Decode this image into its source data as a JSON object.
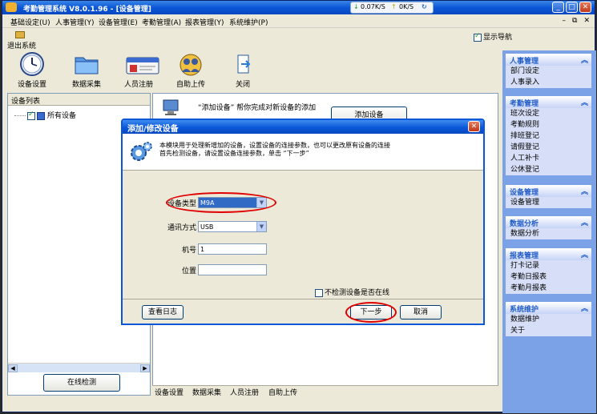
{
  "window": {
    "title": "考勤管理系统 V8.0.1.96 - [设备管理]",
    "speed": {
      "down": "0.07K/S",
      "up": "0K/S"
    }
  },
  "menu": {
    "items": [
      "基础设定(U)",
      "人事管理(Y)",
      "设备管理(E)",
      "考勤管理(A)",
      "报表管理(Y)",
      "系统维护(P)"
    ]
  },
  "toolbar": {
    "exit_label": "退出系统",
    "show_nav_label": "显示导航",
    "buttons": [
      "设备设置",
      "数据采集",
      "人员注册",
      "自助上传",
      "关闭"
    ]
  },
  "device_list": {
    "header": "设备列表",
    "root_item": "所有设备",
    "online_check_button": "在线检测"
  },
  "center": {
    "hint": "“添加设备” 帮你完成对新设备的添加",
    "add_button": "添加设备"
  },
  "bottom_tabs": [
    "设备设置",
    "数据采集",
    "人员注册",
    "自助上传"
  ],
  "nav": {
    "groups": [
      {
        "title": "人事管理",
        "items": [
          "部门设定",
          "人事录入"
        ]
      },
      {
        "title": "考勤管理",
        "items": [
          "班次设定",
          "考勤规则",
          "排班登记",
          "请假登记",
          "人工补卡",
          "公休登记"
        ]
      },
      {
        "title": "设备管理",
        "items": [
          "设备管理"
        ]
      },
      {
        "title": "数据分析",
        "items": [
          "数据分析"
        ]
      },
      {
        "title": "报表管理",
        "items": [
          "打卡记录",
          "考勤日报表",
          "考勤月报表"
        ]
      },
      {
        "title": "系统维护",
        "items": [
          "数据维护",
          "关于"
        ]
      }
    ]
  },
  "dialog": {
    "title": "添加/修改设备",
    "desc_line1": "本模块用于处理新增加的设备，设置设备的连接参数，也可以更改原有设备的连接",
    "desc_line2": "首先检测设备，请设置设备连接参数，单击 “下一步”",
    "device_type_label": "设备类型",
    "device_type_value": "M9A",
    "comm_label": "通讯方式",
    "comm_value": "USB",
    "machine_no_label": "机号",
    "machine_no_value": "1",
    "location_label": "位置",
    "location_value": "",
    "no_check_label": "不检测设备是否在线",
    "log_button": "查看日志",
    "next_button": "下一步",
    "cancel_button": "取消"
  },
  "colors": {
    "titlebar": "#0a57d8",
    "nav_background": "#7ba2e7",
    "annotation": "#e00000",
    "selection": "#316ac5"
  }
}
